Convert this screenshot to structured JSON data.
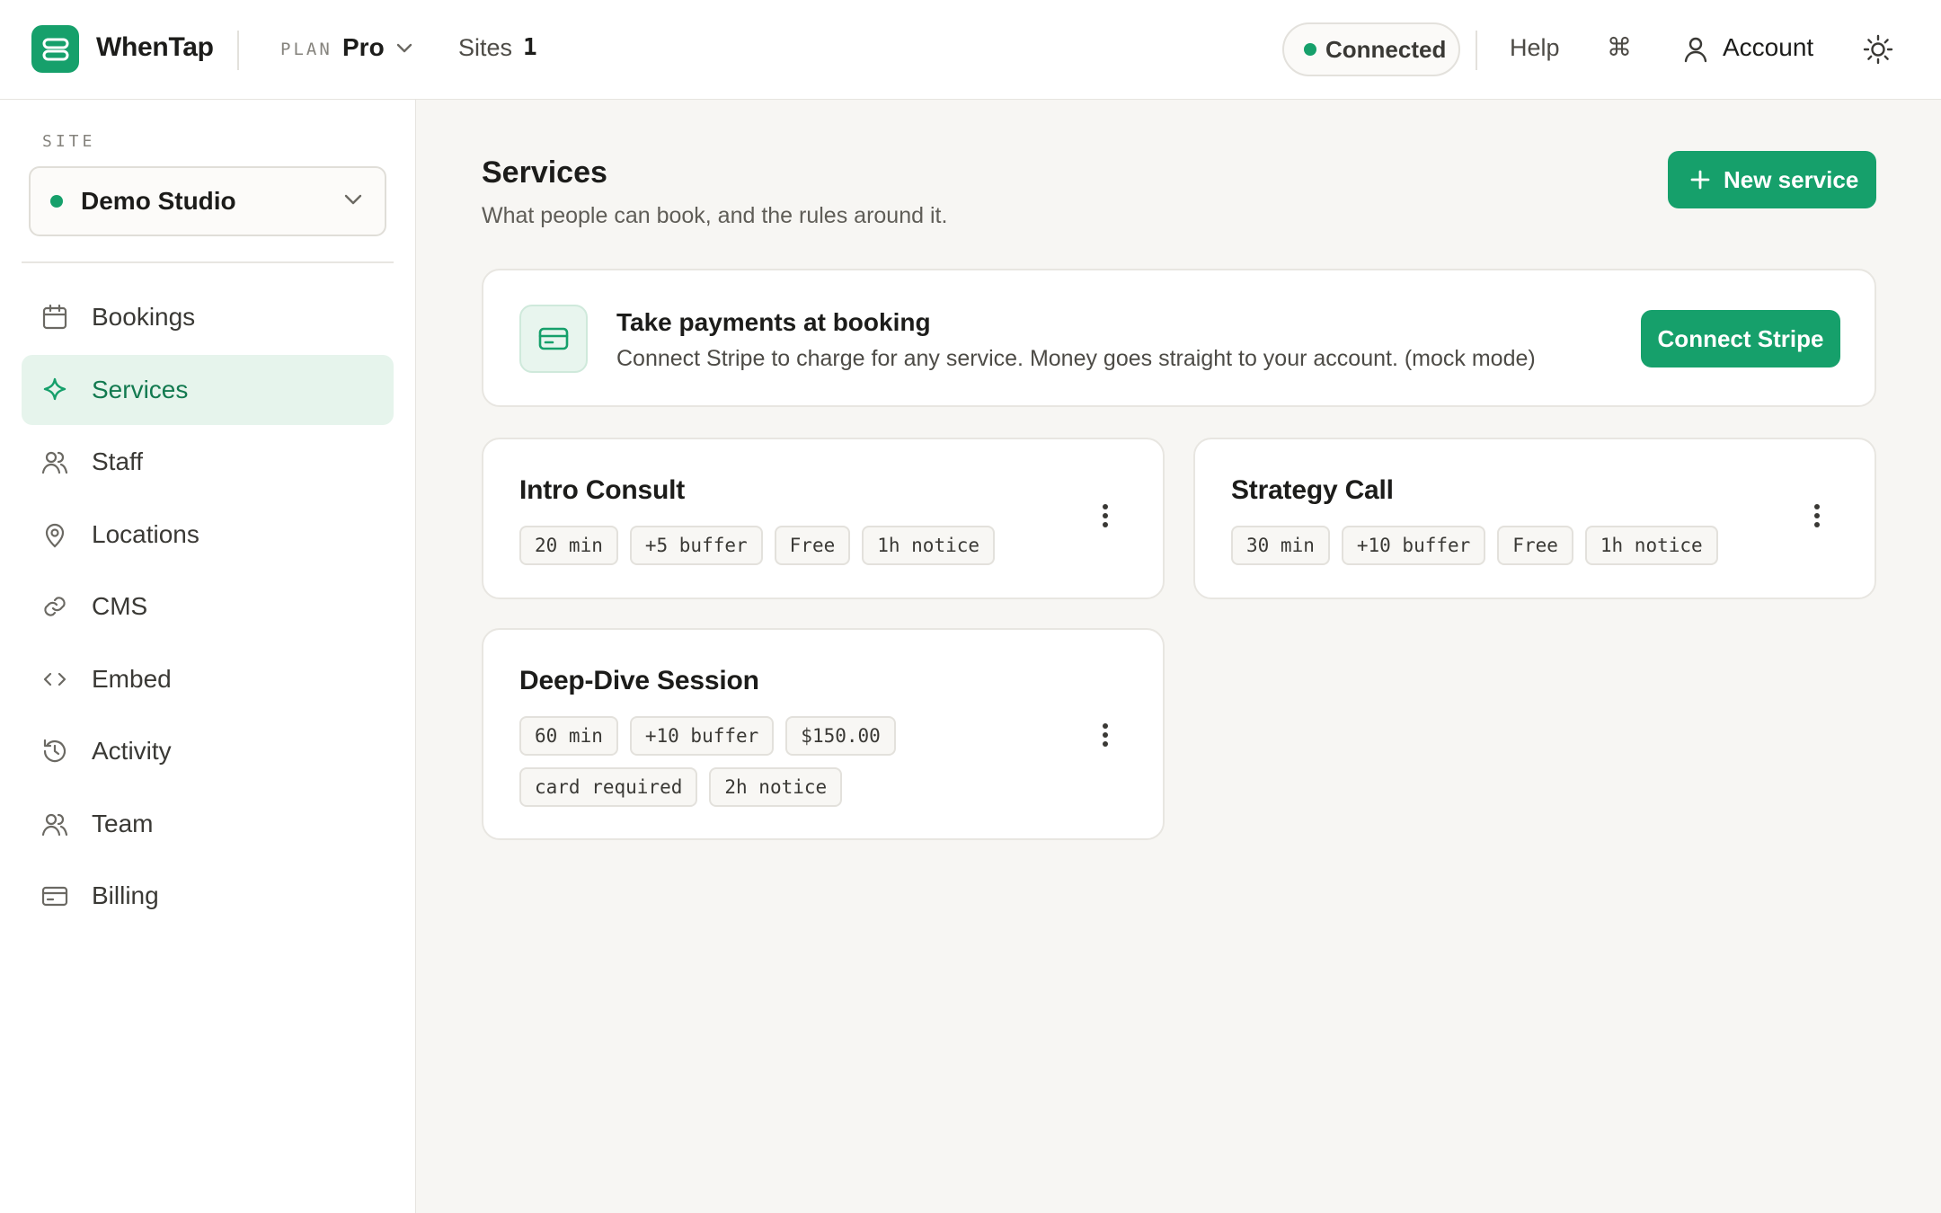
{
  "header": {
    "brand": "WhenTap",
    "plan_label": "PLAN",
    "plan_value": "Pro",
    "sites_label": "Sites",
    "sites_count": "1",
    "status": "Connected",
    "help": "Help",
    "command_glyph": "⌘",
    "account": "Account"
  },
  "sidebar": {
    "site_label": "SITE",
    "site_name": "Demo Studio",
    "items": [
      {
        "label": "Bookings",
        "icon": "calendar-icon"
      },
      {
        "label": "Services",
        "icon": "sparkle-icon",
        "active": true
      },
      {
        "label": "Staff",
        "icon": "users-icon"
      },
      {
        "label": "Locations",
        "icon": "map-pin-icon"
      },
      {
        "label": "CMS",
        "icon": "link-icon"
      },
      {
        "label": "Embed",
        "icon": "code-icon"
      },
      {
        "label": "Activity",
        "icon": "history-icon"
      },
      {
        "label": "Team",
        "icon": "team-icon"
      },
      {
        "label": "Billing",
        "icon": "credit-card-icon"
      }
    ]
  },
  "main": {
    "title": "Services",
    "subtitle": "What people can book, and the rules around it.",
    "new_button": "New service",
    "stripe": {
      "title": "Take payments at booking",
      "description": "Connect Stripe to charge for any service. Money goes straight to your account. (mock mode)",
      "button": "Connect Stripe"
    },
    "services": [
      {
        "name": "Intro Consult",
        "tags": [
          "20 min",
          "+5 buffer",
          "Free",
          "1h notice"
        ]
      },
      {
        "name": "Strategy Call",
        "tags": [
          "30 min",
          "+10 buffer",
          "Free",
          "1h notice"
        ]
      },
      {
        "name": "Deep-Dive Session",
        "tags": [
          "60 min",
          "+10 buffer",
          "$150.00",
          "card required",
          "2h notice"
        ]
      }
    ]
  },
  "colors": {
    "accent": "#16a06b",
    "active_bg": "#e6f4ec",
    "background": "#f7f6f3"
  }
}
